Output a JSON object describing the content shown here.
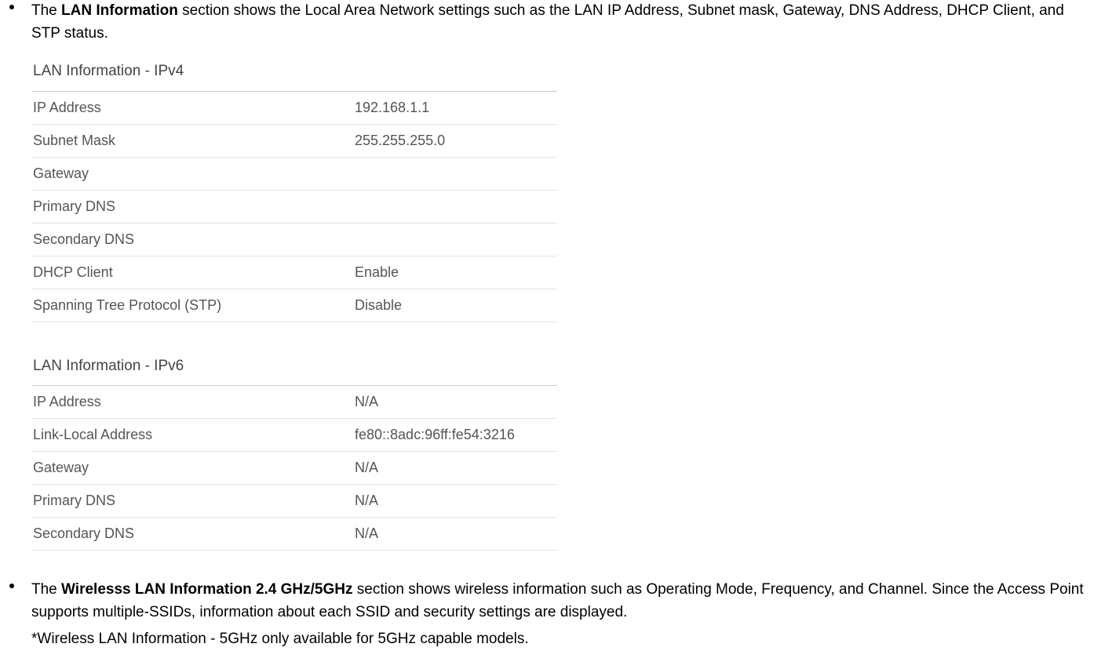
{
  "bullet1": {
    "pre": "The ",
    "bold": "LAN Information",
    "post": " section shows the Local Area Network settings such as the LAN IP Address, Subnet mask, Gateway, DNS Address, DHCP Client, and STP status."
  },
  "ipv4": {
    "heading": "LAN Information - IPv4",
    "rows": [
      {
        "label": "IP Address",
        "value": "192.168.1.1"
      },
      {
        "label": "Subnet Mask",
        "value": "255.255.255.0"
      },
      {
        "label": "Gateway",
        "value": ""
      },
      {
        "label": "Primary DNS",
        "value": ""
      },
      {
        "label": "Secondary DNS",
        "value": ""
      },
      {
        "label": "DHCP Client",
        "value": "Enable"
      },
      {
        "label": "Spanning Tree Protocol (STP)",
        "value": "Disable"
      }
    ]
  },
  "ipv6": {
    "heading": "LAN Information - IPv6",
    "rows": [
      {
        "label": "IP Address",
        "value": "N/A"
      },
      {
        "label": "Link-Local Address",
        "value": "fe80::8adc:96ff:fe54:3216"
      },
      {
        "label": "Gateway",
        "value": "N/A"
      },
      {
        "label": "Primary DNS",
        "value": "N/A"
      },
      {
        "label": "Secondary DNS",
        "value": "N/A"
      }
    ]
  },
  "bullet2": {
    "pre": "The ",
    "bold": "Wirelesss LAN Information 2.4 GHz/5GHz",
    "post": " section shows wireless information such as Operating Mode, Frequency, and Channel. Since the Access Point supports multiple-SSIDs, information about each SSID and security settings are displayed."
  },
  "note": "*Wireless LAN Information - 5GHz only available for 5GHz capable models."
}
